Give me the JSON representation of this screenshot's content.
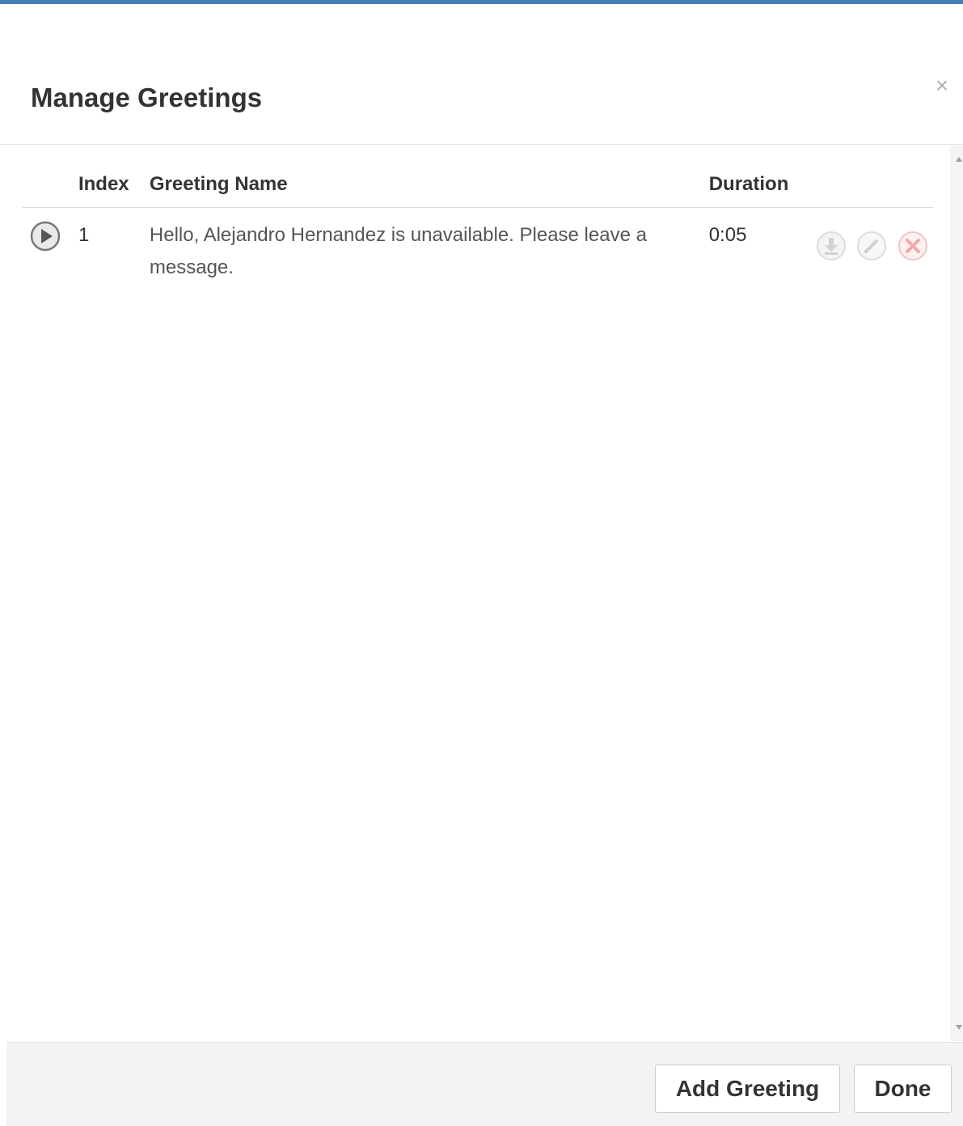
{
  "dialog": {
    "title": "Manage Greetings",
    "close_symbol": "×"
  },
  "table": {
    "headers": {
      "index": "Index",
      "name": "Greeting Name",
      "duration": "Duration"
    },
    "rows": [
      {
        "index": "1",
        "name": "Hello, Alejandro Hernandez is unavailable. Please leave a message.",
        "duration": "0:05",
        "icons": [
          "play-icon",
          "download-icon",
          "edit-icon",
          "delete-icon"
        ]
      }
    ]
  },
  "footer": {
    "add_label": "Add Greeting",
    "done_label": "Done"
  },
  "colors": {
    "accent_bar": "#4a7ebb",
    "footer_bg": "#f3f3f3",
    "icon_disabled": "#d6d6d6",
    "delete_icon": "#f2b4b4"
  }
}
